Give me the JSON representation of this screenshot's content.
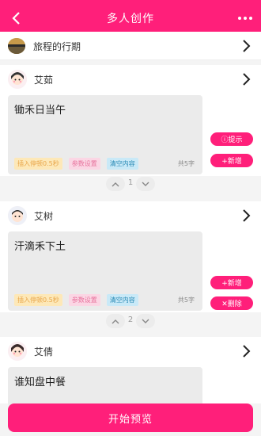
{
  "header": {
    "title": "多人创作"
  },
  "topic": {
    "label": "旅程的行期"
  },
  "cards": [
    {
      "name": "艾茹",
      "content": "锄禾日当午",
      "chips": [
        "插入停顿0.5秒",
        "参数设置",
        "清空内容"
      ],
      "count": "共5字",
      "buttons": [
        "ⓘ提示",
        "+新增"
      ],
      "page": "1"
    },
    {
      "name": "艾树",
      "content": "汗滴禾下土",
      "chips": [
        "插入停顿0.5秒",
        "参数设置",
        "清空内容"
      ],
      "count": "共5字",
      "buttons": [
        "+新增",
        "✕删除"
      ],
      "page": "2"
    },
    {
      "name": "艾倩",
      "content": "谁知盘中餐"
    }
  ],
  "footer": {
    "start_label": "开始预览"
  },
  "colors": {
    "accent": "#ff1f7a"
  }
}
